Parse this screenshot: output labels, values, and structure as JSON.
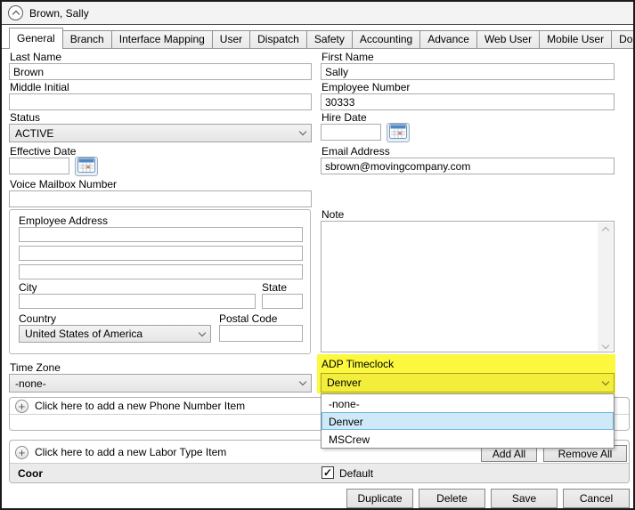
{
  "window": {
    "title": "Brown, Sally"
  },
  "tabs": [
    "General",
    "Branch",
    "Interface Mapping",
    "User",
    "Dispatch",
    "Safety",
    "Accounting",
    "Advance",
    "Web User",
    "Mobile User",
    "Documents"
  ],
  "active_tab": "General",
  "fields": {
    "last_name": {
      "label": "Last Name",
      "value": "Brown"
    },
    "first_name": {
      "label": "First Name",
      "value": "Sally"
    },
    "middle_initial": {
      "label": "Middle Initial",
      "value": ""
    },
    "employee_number": {
      "label": "Employee Number",
      "value": "30333"
    },
    "status": {
      "label": "Status",
      "value": "ACTIVE"
    },
    "hire_date": {
      "label": "Hire Date",
      "value": ""
    },
    "effective_date": {
      "label": "Effective Date",
      "value": ""
    },
    "email": {
      "label": "Email Address",
      "value": "sbrown@movingcompany.com"
    },
    "voice_mailbox": {
      "label": "Voice Mailbox Number",
      "value": ""
    },
    "time_zone": {
      "label": "Time Zone",
      "value": "-none-"
    },
    "adp_timeclock": {
      "label": "ADP Timeclock",
      "value": "Denver"
    }
  },
  "address": {
    "group_label": "Employee Address",
    "line1": "",
    "line2": "",
    "line3": "",
    "city_label": "City",
    "city": "",
    "state_label": "State",
    "state": "",
    "country_label": "Country",
    "country_value": "United States of America",
    "postal_label": "Postal Code",
    "postal": ""
  },
  "note": {
    "label": "Note",
    "value": ""
  },
  "adp_dropdown": {
    "selected": "Denver",
    "options": [
      "-none-",
      "Denver",
      "MSCrew"
    ]
  },
  "phone_section": {
    "add_label": "Click here to add a new Phone Number Item"
  },
  "labor_section": {
    "add_label": "Click here to add a new Labor Type Item",
    "add_all": "Add All",
    "remove_all": "Remove All",
    "row": {
      "name": "Coor",
      "default_label": "Default",
      "default_checked": true
    }
  },
  "footer": {
    "duplicate": "Duplicate",
    "delete": "Delete",
    "save": "Save",
    "cancel": "Cancel"
  },
  "colors": {
    "highlight_yellow": "#fbf83e",
    "selected_item_bg": "#cfe9f8",
    "selected_item_border": "#6fb7e3"
  }
}
